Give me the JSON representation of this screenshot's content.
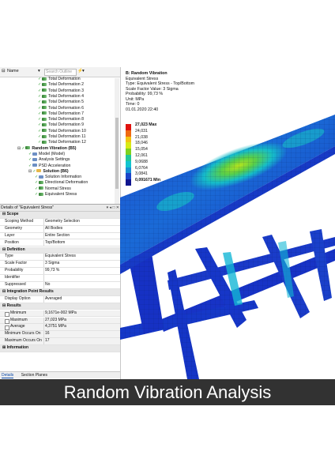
{
  "outline": {
    "column_label": "Name",
    "search_placeholder": "Search Outline",
    "items": [
      {
        "label": "Total Deformation",
        "level": 4,
        "icon": "result"
      },
      {
        "label": "Total Deformation 2",
        "level": 4,
        "icon": "result"
      },
      {
        "label": "Total Deformation 3",
        "level": 4,
        "icon": "result"
      },
      {
        "label": "Total Deformation 4",
        "level": 4,
        "icon": "result"
      },
      {
        "label": "Total Deformation 5",
        "level": 4,
        "icon": "result"
      },
      {
        "label": "Total Deformation 6",
        "level": 4,
        "icon": "result"
      },
      {
        "label": "Total Deformation 7",
        "level": 4,
        "icon": "result"
      },
      {
        "label": "Total Deformation 8",
        "level": 4,
        "icon": "result"
      },
      {
        "label": "Total Deformation 9",
        "level": 4,
        "icon": "result"
      },
      {
        "label": "Total Deformation 10",
        "level": 4,
        "icon": "result"
      },
      {
        "label": "Total Deformation 11",
        "level": 4,
        "icon": "result"
      },
      {
        "label": "Total Deformation 12",
        "level": 4,
        "icon": "result"
      },
      {
        "label": "Random Vibration (B5)",
        "level": 1,
        "icon": "analysis",
        "bold": true
      },
      {
        "label": "Model (Model)",
        "level": 2,
        "icon": "doc"
      },
      {
        "label": "Analysis Settings",
        "level": 2,
        "icon": "doc"
      },
      {
        "label": "PSD Acceleration",
        "level": 2,
        "icon": "doc"
      },
      {
        "label": "Solution (B6)",
        "level": 2,
        "icon": "folder",
        "bold": true
      },
      {
        "label": "Solution Information",
        "level": 3,
        "icon": "doc"
      },
      {
        "label": "Directional Deformation",
        "level": 3,
        "icon": "result"
      },
      {
        "label": "Normal Stress",
        "level": 3,
        "icon": "result"
      },
      {
        "label": "Equivalent Stress",
        "level": 3,
        "icon": "result"
      }
    ]
  },
  "details": {
    "title": "Details of \"Equivalent Stress\"",
    "pin_controls": "▾ ◂ □ ✕",
    "rows": [
      {
        "type": "section",
        "key": "Scope"
      },
      {
        "key": "Scoping Method",
        "value": "Geometry Selection"
      },
      {
        "key": "Geometry",
        "value": "All Bodies"
      },
      {
        "key": "Layer",
        "value": "Entire Section"
      },
      {
        "key": "Position",
        "value": "Top/Bottom"
      },
      {
        "type": "section",
        "key": "Definition"
      },
      {
        "key": "Type",
        "value": "Equivalent Stress"
      },
      {
        "key": "Scale Factor",
        "value": "3 Sigma"
      },
      {
        "key": "Probability",
        "value": "99,73 %"
      },
      {
        "key": "Identifier",
        "value": ""
      },
      {
        "key": "Suppressed",
        "value": "No"
      },
      {
        "type": "section",
        "key": "Integration Point Results"
      },
      {
        "key": "Display Option",
        "value": "Averaged"
      },
      {
        "type": "section",
        "key": "Results"
      },
      {
        "key": "Minimum",
        "value": "9,1671e-002 MPa",
        "checkbox": true
      },
      {
        "key": "Maximum",
        "value": "27,023 MPa",
        "checkbox": true
      },
      {
        "key": "Average",
        "value": "4,3751 MPa",
        "checkbox": true
      },
      {
        "key": "Minimum Occurs On",
        "value": "16"
      },
      {
        "key": "Maximum Occurs On",
        "value": "17"
      },
      {
        "type": "section",
        "key": "Information"
      }
    ]
  },
  "bottom_tabs": {
    "details": "Details",
    "section_planes": "Section Planes"
  },
  "result_info": {
    "title": "B: Random Vibration",
    "lines": [
      "Equivalent Stress",
      "Type: Equivalent Stress - Top/Bottom",
      "Scale Factor Value: 3 Sigma",
      "Probability: 99,73 %",
      "Unit: MPa",
      "Time: 0",
      "01.01.2020 22:40"
    ]
  },
  "legend": {
    "entries": [
      {
        "label": "27,023 Max",
        "color": "#e0130e",
        "bold": true
      },
      {
        "label": "24,031",
        "color": "#ef6a10"
      },
      {
        "label": "21,038",
        "color": "#f2c311"
      },
      {
        "label": "18,046",
        "color": "#d8ea16"
      },
      {
        "label": "15,054",
        "color": "#7fd21e"
      },
      {
        "label": "12,061",
        "color": "#22c79a"
      },
      {
        "label": "9,0688",
        "color": "#12c4cf"
      },
      {
        "label": "6,0764",
        "color": "#198fd4"
      },
      {
        "label": "3,0841",
        "color": "#1b45c9"
      },
      {
        "label": "0,091671 Min",
        "color": "#10158f",
        "bold": true
      }
    ]
  },
  "colors": {
    "mesh_blue": "#1636c8",
    "mesh_cyan": "#14b7d6",
    "mesh_green": "#5fd23a",
    "banner": "#323232"
  },
  "banner": {
    "text": "Random Vibration Analysis"
  }
}
